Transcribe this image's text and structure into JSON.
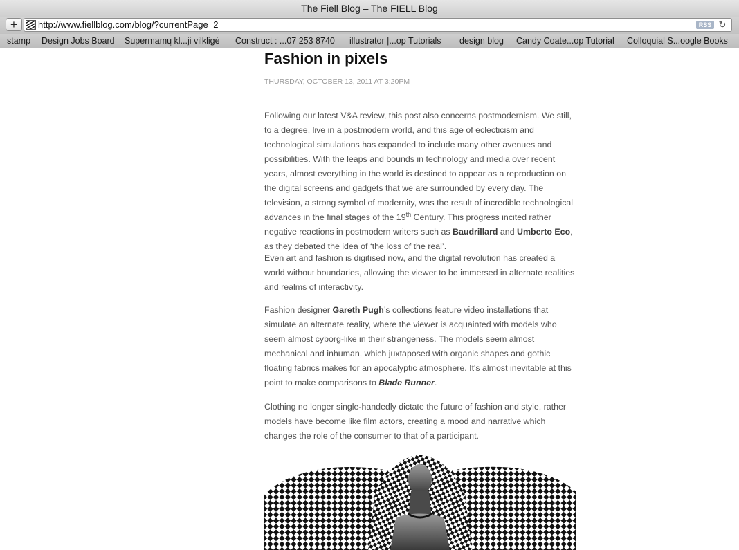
{
  "window": {
    "title": "The Fiell Blog – The FIELL Blog"
  },
  "toolbar": {
    "add_label": "+",
    "url": "http://www.fiellblog.com/blog/?currentPage=2",
    "rss_label": "RSS",
    "reload_icon": "reload-icon"
  },
  "bookmarks": [
    "stamp",
    "Design Jobs Board",
    "Supermamų kl...ji vilkligė",
    "Construct : ...07 253 8740",
    "illustrator |...op Tutorials",
    "design blog",
    "Candy Coate...op Tutorial",
    "Colloquial S...oogle Books"
  ],
  "post": {
    "title": "Fashion in pixels",
    "date": "THURSDAY, OCTOBER 13, 2011 AT 3:20PM",
    "p1": {
      "a": "Following our latest V&A review, this post also concerns postmodernism. We still, to a degree, live in a postmodern world, and this age of eclecticism and technological simulations has expanded to include many other avenues and possibilities. With the leaps and bounds in technology and media over recent years, almost everything in the world is destined to appear as a reproduction on the digital screens and gadgets that we are surrounded by every day. The television, a strong symbol of modernity, was the result of incredible technological advances in the final stages of the 19",
      "sup": "th",
      "b": " Century. This progress incited rather negative reactions in postmodern writers such as ",
      "name1": "Baudrillard",
      "c": " and ",
      "name2": "Umberto Eco",
      "d": ", as they debated the idea of ‘the loss of the real’."
    },
    "p2": "Even art and fashion is digitised now, and the digital revolution has created a world without boundaries, allowing the viewer to be immersed in alternate realities and realms of interactivity.",
    "p3": {
      "a": "Fashion designer ",
      "name": "Gareth Pugh",
      "b": "’s collections feature video installations that simulate an alternate reality, where the viewer is acquainted with models who seem almost cyborg-like in their strangeness. The models seem almost mechanical and inhuman, which juxtaposed with organic shapes and gothic floating fabrics makes for an apocalyptic atmosphere. It's almost inevitable at this point to make comparisons to ",
      "film": "Blade Runner",
      "c": "."
    },
    "p4": "Clothing no longer single-handedly dictate the future of fashion and style, rather models have become like film actors, creating a mood and narrative which changes the role of the consumer to that of a participant.",
    "image_subject": "model in black-and-white checkered garment"
  }
}
